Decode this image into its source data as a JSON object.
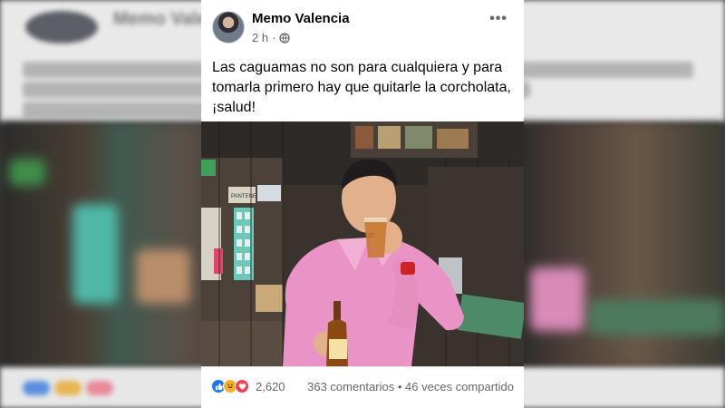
{
  "post": {
    "author": "Memo Valencia",
    "time": "2 h",
    "separator": "·",
    "text": "Las caguamas no son para cualquiera y para tomarla primero hay que quitarle la corcholata, ¡salud!",
    "reaction_count": "2,620",
    "comments": "363 comentarios",
    "dot": "•",
    "shares": "46 veces compartido"
  },
  "photo": {
    "sign_text": "PANTENE"
  },
  "icons": {
    "privacy": "globe-icon",
    "more": "more-options-icon",
    "reactions": [
      "like-icon",
      "haha-icon",
      "love-icon"
    ]
  },
  "colors": {
    "name": "#050505",
    "meta": "#65676b",
    "like": "#1877f2",
    "haha": "#f7b125",
    "love": "#f33e58",
    "shirt": "#e58fc0"
  }
}
